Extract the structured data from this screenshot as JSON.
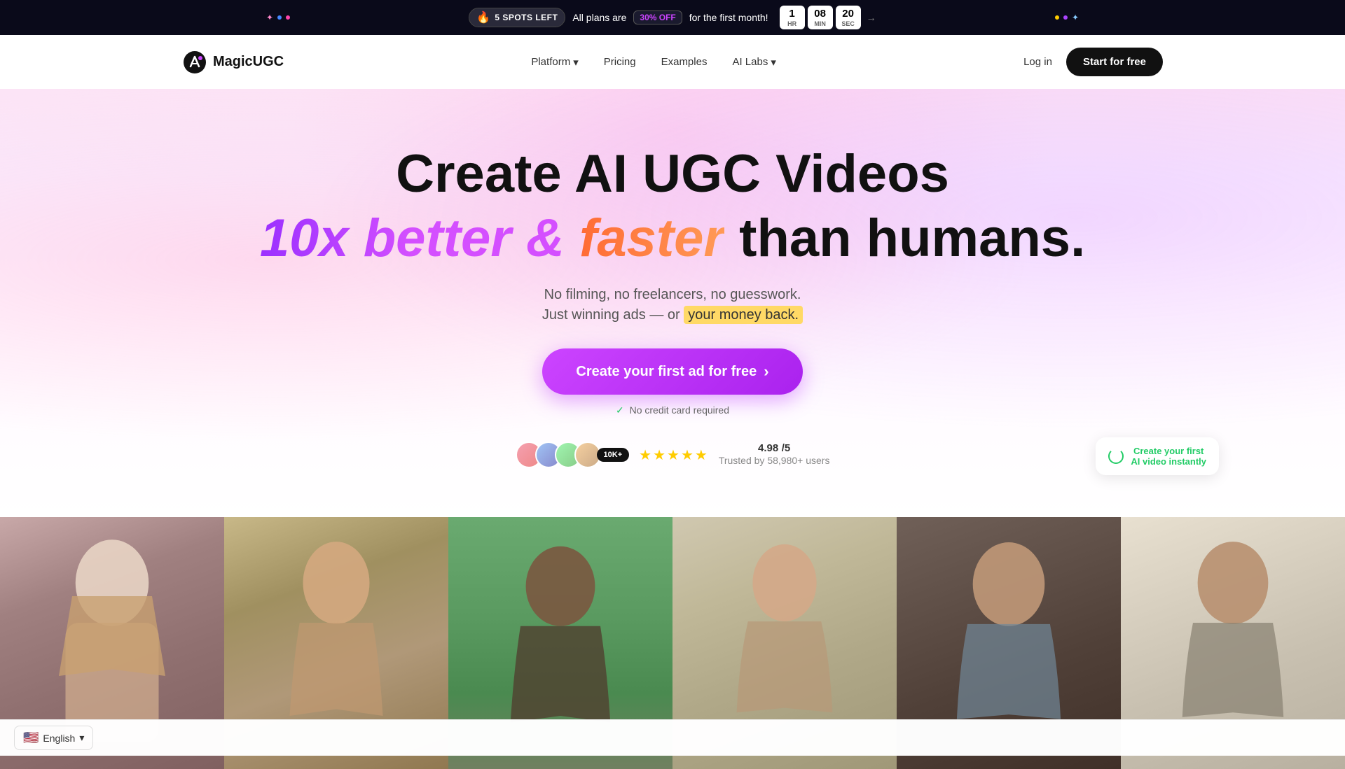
{
  "banner": {
    "spots_left": "5 SPOTS LEFT",
    "fire_emoji": "🔥",
    "plans_text": "All plans are",
    "discount": "30% OFF",
    "for_first_month": "for the first month!",
    "timer": {
      "hours": "1",
      "hours_label": "HR",
      "minutes": "08",
      "minutes_label": "MIN",
      "seconds": "20",
      "seconds_label": "SEC"
    }
  },
  "nav": {
    "logo_text": "MagicUGC",
    "links": [
      {
        "label": "Platform",
        "has_arrow": true
      },
      {
        "label": "Pricing",
        "has_arrow": false
      },
      {
        "label": "Examples",
        "has_arrow": false
      },
      {
        "label": "AI Labs",
        "has_arrow": true
      }
    ],
    "login": "Log in",
    "start_free": "Start for free"
  },
  "hero": {
    "title_line1": "Create AI UGC Videos",
    "title_line2_part1": "10x better &",
    "title_line2_part2": "faster",
    "title_line2_part3": "than humans.",
    "desc1": "No filming, no freelancers, no guesswork.",
    "desc2_before": "Just winning ads — or",
    "desc2_highlight": "your money back.",
    "cta_button": "Create your first ad for free",
    "cta_arrow": "›",
    "no_cc": "No credit card required",
    "rating": "4.98",
    "rating_max": "/5",
    "trusted": "Trusted by 58,980+ users",
    "badge_10k": "10K+"
  },
  "tooltip": {
    "line1": "Create your first",
    "line2": "AI video instantly"
  },
  "footer": {
    "language": "English"
  },
  "video_cards": [
    {
      "id": 1,
      "color_class": "vc1"
    },
    {
      "id": 2,
      "color_class": "vc2"
    },
    {
      "id": 3,
      "color_class": "vc3"
    },
    {
      "id": 4,
      "color_class": "vc4"
    },
    {
      "id": 5,
      "color_class": "vc5"
    },
    {
      "id": 6,
      "color_class": "vc6"
    }
  ],
  "colors": {
    "accent_purple": "#cc44ff",
    "accent_orange": "#ff6b35",
    "black": "#111111",
    "green": "#22cc66"
  }
}
